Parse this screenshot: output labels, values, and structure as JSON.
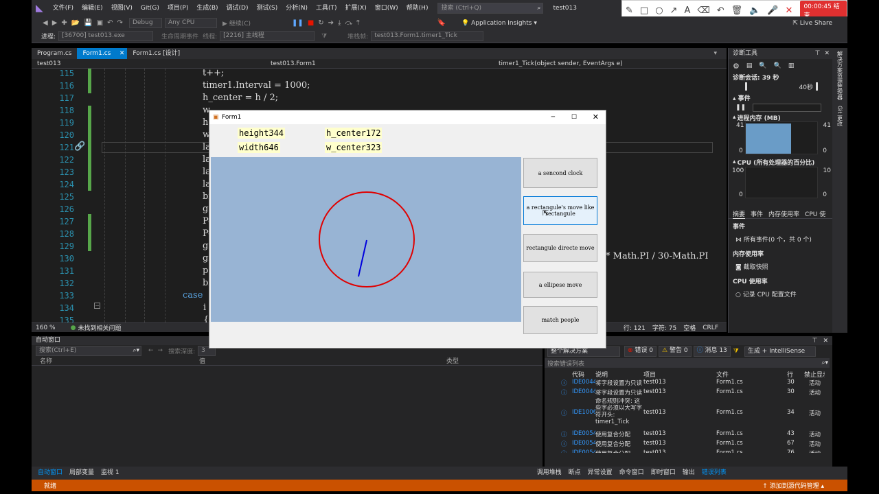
{
  "menu": {
    "items": [
      "文件(F)",
      "编辑(E)",
      "视图(V)",
      "Git(G)",
      "项目(P)",
      "生成(B)",
      "调试(D)",
      "测试(S)",
      "分析(N)",
      "工具(T)",
      "扩展(X)",
      "窗口(W)",
      "帮助(H)"
    ],
    "search_placeholder": "搜索 (Ctrl+Q)",
    "solution_name": "test013"
  },
  "toolbar": {
    "config": "Debug",
    "platform": "Any CPU",
    "continue_label": "继续(C)",
    "insights_label": "Application Insights",
    "live_share": "Live Share"
  },
  "debugbar": {
    "process_label": "进程:",
    "process_value": "[36700] test013.exe",
    "lifecycle_label": "生命周期事件",
    "thread_label": "线程:",
    "thread_value": "[2216] 主线程",
    "stack_label": "堆栈帧:",
    "stack_value": "test013.Form1.timer1_Tick"
  },
  "tabs": [
    {
      "label": "Program.cs"
    },
    {
      "label": "Form1.cs"
    },
    {
      "label": "Form1.cs [设计]"
    }
  ],
  "navbar": {
    "project": "test013",
    "type": "test013.Form1",
    "member": "timer1_Tick(object sender, EventArgs e)"
  },
  "editor": {
    "lines": [
      {
        "num": "115",
        "code": "t++;"
      },
      {
        "num": "116",
        "code": "timer1.Interval = 1000;"
      },
      {
        "num": "117",
        "code": "h_center = h / 2;"
      },
      {
        "num": "118",
        "code": "w"
      },
      {
        "num": "119",
        "code": "h"
      },
      {
        "num": "120",
        "code": "w"
      },
      {
        "num": "121",
        "code": "la"
      },
      {
        "num": "122",
        "code": "la"
      },
      {
        "num": "123",
        "code": "la"
      },
      {
        "num": "124",
        "code": "la"
      },
      {
        "num": "125",
        "code": "bi"
      },
      {
        "num": "126",
        "code": "gr"
      },
      {
        "num": "127",
        "code": "Pe"
      },
      {
        "num": "128",
        "code": "Pe"
      },
      {
        "num": "129",
        "code": "gr"
      },
      {
        "num": "130",
        "code": "gr"
      },
      {
        "num": "131",
        "code": "p"
      },
      {
        "num": "132",
        "code": "bi"
      },
      {
        "num": "133",
        "code": "case"
      },
      {
        "num": "134",
        "code": "i"
      },
      {
        "num": "135",
        "code": "{"
      }
    ],
    "overflow_text": "* Math.PI / 30-Math.PI",
    "zoom": "160 %",
    "issues": "未找到相关问题",
    "row": "行: 121",
    "col": "字符: 75",
    "spaces": "空格",
    "eol": "CRLF"
  },
  "diagnostics": {
    "title": "诊断工具",
    "session": "诊断会话: 39 秒",
    "timeline_label": "40秒",
    "events_label": "事件",
    "memory_label": "进程内存 (MB)",
    "mem_max": "41",
    "mem_min": "0",
    "cpu_label": "CPU (所有处理器的百分比)",
    "cpu_max": "100",
    "cpu_max_right": "10",
    "cpu_min": "0",
    "tabs": [
      "摘要",
      "事件",
      "内存使用率",
      "CPU 使"
    ],
    "events_heading": "事件",
    "all_events": "所有事件(0 个，共 0 个)",
    "memory_heading": "内存使用率",
    "snapshot": "截取快照",
    "cpu_heading": "CPU 使用率",
    "record_cpu": "记录 CPU 配置文件",
    "memory_fill": 0.95
  },
  "side_tabs": [
    "解决方案资源管理器",
    "Git 更改"
  ],
  "autos": {
    "title": "自动窗口",
    "search_placeholder": "搜索(Ctrl+E)",
    "depth_label": "搜索深度:",
    "depth_value": "3",
    "col_name": "名称",
    "col_value": "值",
    "col_type": "类型"
  },
  "errors": {
    "scope": "整个解决方案",
    "errors_btn": "错误 0",
    "warnings_btn": "警告 0",
    "messages_btn": "消息 13",
    "build_filter": "生成 + IntelliSense",
    "search_placeholder": "搜索错误列表",
    "headers": [
      "代码",
      "说明",
      "项目",
      "文件",
      "行",
      "禁止显示"
    ],
    "rows": [
      {
        "code": "IDE0044",
        "desc": "将字段设置为只读",
        "project": "test013",
        "file": "Form1.cs",
        "line": "30",
        "state": "活动"
      },
      {
        "code": "IDE0044",
        "desc": "将字段设置为只读",
        "project": "test013",
        "file": "Form1.cs",
        "line": "30",
        "state": "活动"
      },
      {
        "code": "IDE1006",
        "desc": "命名规则冲突: 这些字必须以大写字符开头: timer1_Tick",
        "project": "test013",
        "file": "Form1.cs",
        "line": "34",
        "state": "活动"
      },
      {
        "code": "IDE0054",
        "desc": "使用复合分配",
        "project": "test013",
        "file": "Form1.cs",
        "line": "43",
        "state": "活动"
      },
      {
        "code": "IDE0054",
        "desc": "使用复合分配",
        "project": "test013",
        "file": "Form1.cs",
        "line": "67",
        "state": "活动"
      },
      {
        "code": "IDE0054",
        "desc": "使用复合分配",
        "project": "test013",
        "file": "Form1.cs",
        "line": "76",
        "state": "活动"
      }
    ]
  },
  "bottom_tabs_left": [
    "自动窗口",
    "局部变量",
    "监视 1"
  ],
  "bottom_tabs_right": [
    "调用堆栈",
    "断点",
    "异常设置",
    "命令窗口",
    "即时窗口",
    "输出",
    "错误列表"
  ],
  "statusbar": {
    "ready": "就绪",
    "source_control": "添加到源代码管理"
  },
  "recorder": {
    "time": "00:00:45 结束"
  },
  "form1": {
    "title": "Form1",
    "label_height": "height344",
    "label_hcenter": "h_center172",
    "label_width": "width646",
    "label_wcenter": "w_center323",
    "buttons": [
      "a sencond clock",
      "a rectangule's move like rectangule",
      "rectangule directe move",
      "a ellipese move",
      "match people"
    ],
    "clock_colors": {
      "circle": "#e00000",
      "hand": "#0000dd"
    }
  },
  "colors": {
    "accent": "#007acc",
    "status": "#ca5100"
  }
}
